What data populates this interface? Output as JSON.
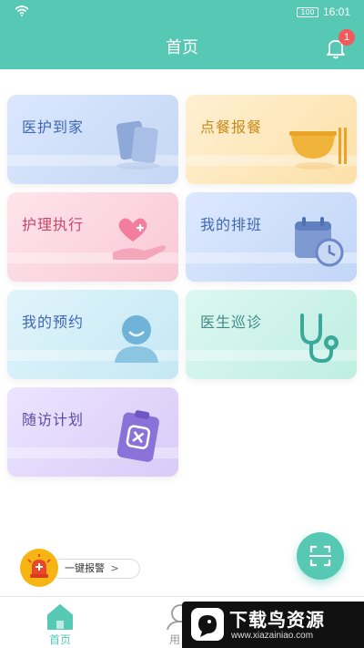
{
  "status_bar": {
    "battery": "100",
    "time": "16:01"
  },
  "header": {
    "title": "首页",
    "notification_count": "1"
  },
  "cards": [
    {
      "label": "医护到家",
      "icon": "cards-icon"
    },
    {
      "label": "点餐报餐",
      "icon": "bowl-icon"
    },
    {
      "label": "护理执行",
      "icon": "heart-hand-icon"
    },
    {
      "label": "我的排班",
      "icon": "calendar-clock-icon"
    },
    {
      "label": "我的预约",
      "icon": "person-icon"
    },
    {
      "label": "医生巡诊",
      "icon": "stethoscope-icon"
    },
    {
      "label": "随访计划",
      "icon": "clipboard-icon"
    }
  ],
  "alarm": {
    "label": "一键报警",
    "chevron": ">"
  },
  "nav": {
    "home_label": "首页",
    "user_label": "用"
  },
  "watermark": {
    "title": "下载鸟资源",
    "url": "www.xiazainiao.com"
  },
  "colors": {
    "primary": "#56c8b3",
    "badge": "#f15a5a",
    "alarm": "#f7b514"
  }
}
